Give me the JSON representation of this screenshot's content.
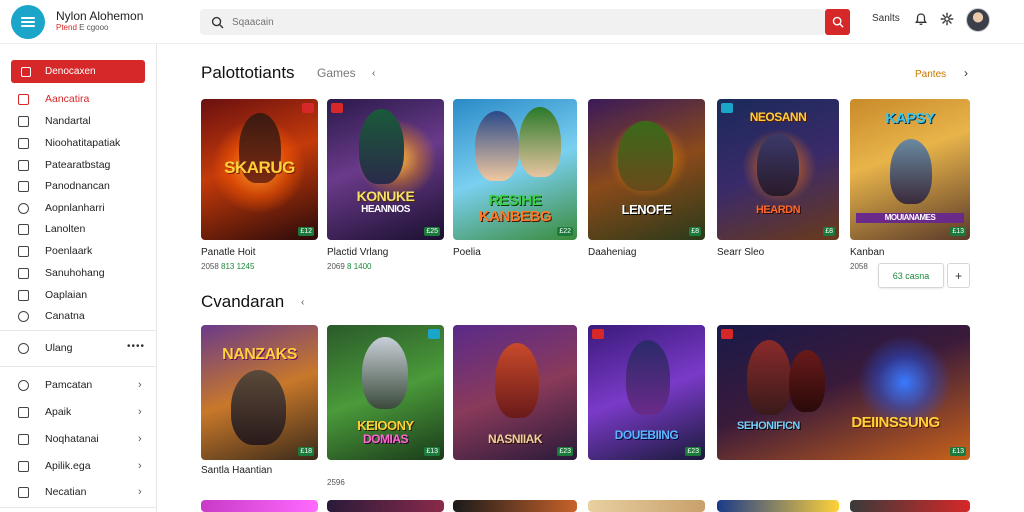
{
  "header": {
    "brand_title": "Nylon Alohemon",
    "brand_sub_red": "Ptend",
    "brand_sub": "E cgooo",
    "search_placeholder": "Sqaacain",
    "top_link": "Sanlts",
    "icons": [
      "menu-icon",
      "search-icon",
      "bell-icon",
      "gear-icon"
    ]
  },
  "sidebar": {
    "active_label": "Denocaxen",
    "items": [
      {
        "label": "Aancatira"
      },
      {
        "label": "Nandartal"
      },
      {
        "label": "Nioohatitapatiak"
      },
      {
        "label": "Patearatbstag"
      },
      {
        "label": "Panodnancan"
      },
      {
        "label": "Aopnlanharri"
      },
      {
        "label": "Lanolten"
      },
      {
        "label": "Poenlaark"
      },
      {
        "label": "Sanuhohang"
      },
      {
        "label": "Oaplaian"
      },
      {
        "label": "Canatna"
      }
    ],
    "more_label": "Ulang",
    "more_dots": "••••",
    "bottom_items": [
      {
        "label": "Pamcatan"
      },
      {
        "label": "Apaik"
      },
      {
        "label": "Noqhatanai"
      },
      {
        "label": "Apilik.ega"
      },
      {
        "label": "Necatian"
      }
    ]
  },
  "section1": {
    "title": "Palottotiants",
    "subtitle": "Games",
    "arrow": "‹",
    "see_all": "Pantes",
    "cards": [
      {
        "logo": "SKARUG",
        "sub": "",
        "title": "Panatle Hoit",
        "meta1": "2058 ",
        "meta2": "813 1245",
        "price": "£12"
      },
      {
        "logo": "KONUKE",
        "sub": "HEANNIOS",
        "title": "Plactid Vrlang",
        "meta1": "2069 ",
        "meta2": "8 1400",
        "price": "£25"
      },
      {
        "logo": "RESIHE",
        "sub": "KANBEBG",
        "title": "Poelia",
        "meta1": "",
        "meta2": "",
        "price": "£22"
      },
      {
        "logo": "LENOFE",
        "sub": "",
        "title": "Daaheniag",
        "meta1": "",
        "meta2": "",
        "price": "£8"
      },
      {
        "logo": "NEOSANN",
        "sub": "HEARDN",
        "title": "Searr Sleo",
        "meta1": "",
        "meta2": "",
        "price": "£8"
      },
      {
        "logo": "KAPSY",
        "sub": "MOUIANAMES",
        "title": "Kanban",
        "meta1": "2058",
        "meta2": "",
        "price": "£13"
      }
    ],
    "chip_label": "63 casna",
    "plus_label": "+"
  },
  "section2": {
    "title": "Cvandaran",
    "arrow": "‹",
    "cards": [
      {
        "logo": "NANZAKS",
        "sub": "",
        "price": "£18"
      },
      {
        "logo": "KEIOONY",
        "sub": "DOMIAS",
        "price": "£13"
      },
      {
        "logo": "NASNIIAK",
        "sub": "",
        "price": "£23"
      },
      {
        "logo": "DOUEBIING",
        "sub": "",
        "price": "£23"
      },
      {
        "logo": "DEIINSSUNG",
        "sub": "SEHONIFICN",
        "price": "£13"
      }
    ],
    "row_title": "Santla Haantian",
    "row_meta": "2596"
  }
}
